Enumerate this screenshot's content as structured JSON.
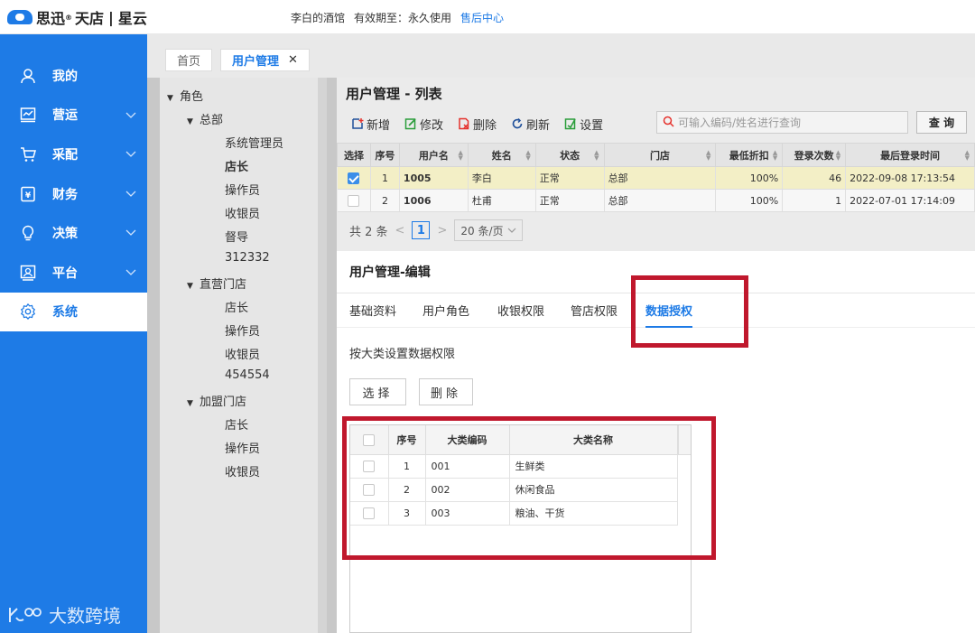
{
  "header": {
    "brand": "思迅",
    "brand_sup": "®",
    "product": "天店",
    "sep": "|",
    "product2": "星云",
    "store": "李白的酒馆",
    "validity_label": "有效期至：",
    "validity_value": "永久使用",
    "support_link": "售后中心"
  },
  "sidebar": {
    "items": [
      {
        "label": "我的",
        "icon": "user-icon"
      },
      {
        "label": "营运",
        "icon": "chart-icon"
      },
      {
        "label": "采配",
        "icon": "cart-icon"
      },
      {
        "label": "财务",
        "icon": "finance-icon"
      },
      {
        "label": "决策",
        "icon": "bulb-icon"
      },
      {
        "label": "平台",
        "icon": "platform-icon"
      },
      {
        "label": "系统",
        "icon": "gear-icon"
      }
    ],
    "active_index": 6,
    "watermark": "大数跨境"
  },
  "tabs": {
    "home": "首页",
    "current": "用户管理",
    "close": "✕"
  },
  "tree": {
    "root": "角色",
    "groups": [
      {
        "label": "总部",
        "children": [
          "系统管理员",
          "店长",
          "操作员",
          "收银员",
          "督导",
          "312332"
        ]
      },
      {
        "label": "直营门店",
        "children": [
          "店长",
          "操作员",
          "收银员",
          "454554"
        ]
      },
      {
        "label": "加盟门店",
        "children": [
          "店长",
          "操作员",
          "收银员"
        ]
      }
    ]
  },
  "list": {
    "title": "用户管理 - 列表",
    "toolbar": [
      "新增",
      "修改",
      "删除",
      "刷新",
      "设置"
    ],
    "search_placeholder": "可输入编码/姓名进行查询",
    "query_button": "查 询",
    "columns": [
      "选择",
      "序号",
      "用户名",
      "姓名",
      "状态",
      "门店",
      "最低折扣",
      "登录次数",
      "最后登录时间"
    ],
    "rows": [
      {
        "selected": true,
        "index": "1",
        "username": "1005",
        "name": "李白",
        "status": "正常",
        "store": "总部",
        "discount": "100%",
        "logins": "46",
        "last_login": "2022-09-08 17:13:54"
      },
      {
        "selected": false,
        "index": "2",
        "username": "1006",
        "name": "杜甫",
        "status": "正常",
        "store": "总部",
        "discount": "100%",
        "logins": "1",
        "last_login": "2022-07-01 17:14:09"
      }
    ],
    "pager": {
      "total": "共 2 条",
      "prev": "<",
      "page": "1",
      "next": ">",
      "page_size": "20 条/页"
    }
  },
  "edit": {
    "title": "用户管理-编辑",
    "tabs": [
      "基础资料",
      "用户角色",
      "收银权限",
      "管店权限",
      "数据授权"
    ],
    "active_tab": 4,
    "description": "按大类设置数据权限",
    "select_button": "选择",
    "delete_button": "删除",
    "columns": [
      "序号",
      "大类编码",
      "大类名称"
    ],
    "rows": [
      {
        "index": "1",
        "code": "001",
        "name": "生鲜类"
      },
      {
        "index": "2",
        "code": "002",
        "name": "休闲食品"
      },
      {
        "index": "3",
        "code": "003",
        "name": "粮油、干货"
      }
    ]
  },
  "colors": {
    "primary": "#1e7be6",
    "highlight": "#c0182d",
    "selected_row": "#f3efc6"
  }
}
